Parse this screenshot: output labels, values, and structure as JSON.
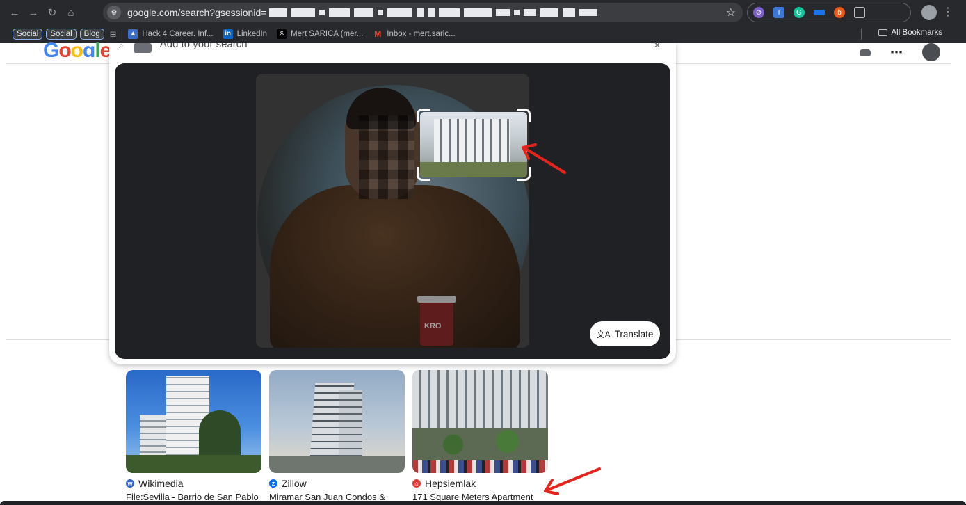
{
  "browser": {
    "url": "google.com/search?gsessionid=",
    "bookmarks": {
      "chips": [
        "Social",
        "Social",
        "Blog"
      ],
      "items": [
        {
          "label": "Hack 4 Career. Inf...",
          "icon": "hack4career-icon",
          "color": "#3b6cc9"
        },
        {
          "label": "LinkedIn",
          "icon": "linkedin-icon",
          "color": "#0a66c2"
        },
        {
          "label": "Mert SARICA (mer...",
          "icon": "x-icon",
          "color": "#000000"
        },
        {
          "label": "Inbox - mert.saric...",
          "icon": "gmail-icon",
          "color": "#ea4335"
        }
      ],
      "all_bookmarks": "All Bookmarks"
    }
  },
  "google": {
    "logo": [
      "G",
      "o",
      "o",
      "g",
      "l",
      "e"
    ]
  },
  "lens": {
    "search_placeholder": "Add to your search",
    "translate_label": "Translate",
    "cup_text": "KRO"
  },
  "results": [
    {
      "source": "Wikimedia",
      "source_icon": "wikimedia-icon",
      "source_color": "#3366cc",
      "title": "File:Sevilla - Barrio de San Pablo"
    },
    {
      "source": "Zillow",
      "source_icon": "zillow-icon",
      "source_color": "#006aff",
      "title": "Miramar San Juan Condos &"
    },
    {
      "source": "Hepsiemlak",
      "source_icon": "hepsiemlak-icon",
      "source_color": "#e53935",
      "title": "171 Square Meters Apartment"
    }
  ],
  "colors": {
    "chrome_bg": "#28292d",
    "annotation_red": "#e5251d",
    "lens_bg": "#202124"
  }
}
